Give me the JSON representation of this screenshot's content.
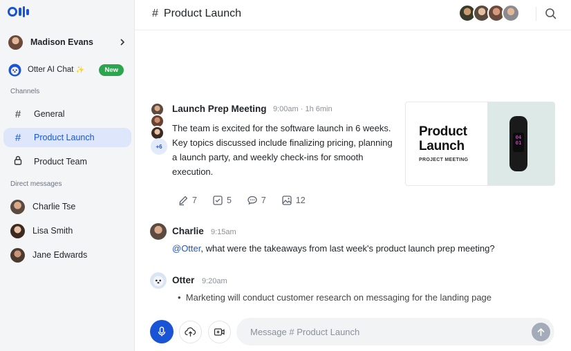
{
  "app": {
    "logo": "Otter"
  },
  "sidebar": {
    "user": {
      "name": "Madison Evans",
      "chevron": ">"
    },
    "otter_chat": {
      "label": "Otter AI Chat",
      "sparkle": "✨",
      "badge": "New"
    },
    "channels_label": "Channels",
    "channels": [
      {
        "icon": "hash-icon",
        "label": "General",
        "active": false
      },
      {
        "icon": "hash-icon",
        "label": "Product Launch",
        "active": true
      },
      {
        "icon": "lock-icon",
        "label": "Product Team",
        "active": false
      }
    ],
    "dm_label": "Direct messages",
    "direct_messages": [
      {
        "label": "Charlie Tse"
      },
      {
        "label": "Lisa Smith"
      },
      {
        "label": "Jane Edwards"
      }
    ]
  },
  "header": {
    "hash": "#",
    "title": "Product Launch",
    "search_icon": "search-icon"
  },
  "meeting": {
    "title": "Launch Prep Meeting",
    "time": "9:00am",
    "duration": "· 1h 6min",
    "extra_participants": "+6",
    "summary": "The team is excited for the software launch in 6 weeks. Key topics discussed include finalizing pricing, planning a launch party, and weekly check-ins for smooth execution.",
    "thumbnail": {
      "title_line1": "Product",
      "title_line2": "Launch",
      "subtitle": "PROJECT MEETING",
      "screen_line1": "04",
      "screen_line2": "01"
    },
    "stats": [
      {
        "icon": "pencil-icon",
        "value": "7"
      },
      {
        "icon": "checkbox-icon",
        "value": "5"
      },
      {
        "icon": "comment-icon",
        "value": "7"
      },
      {
        "icon": "image-icon",
        "value": "12"
      }
    ]
  },
  "messages": [
    {
      "name": "Charlie",
      "time": "9:15am",
      "mention": "@Otter",
      "text": ", what were the takeaways from last week's product launch prep meeting?"
    },
    {
      "name": "Otter",
      "time": "9:20am",
      "bullets": [
        "Marketing will conduct customer research on messaging for the landing page"
      ]
    }
  ],
  "composer": {
    "placeholder": "Message # Product Launch"
  },
  "colors": {
    "accent": "#1a54d6",
    "new_badge": "#2da44e",
    "active_bg": "#dde6fb"
  }
}
